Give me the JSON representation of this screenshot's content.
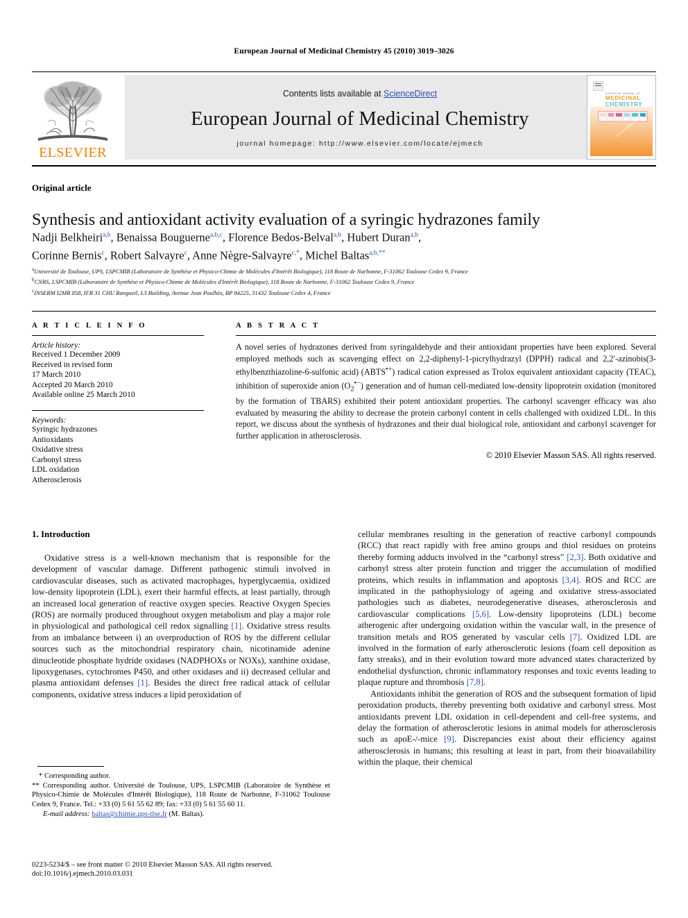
{
  "running_head": "European Journal of Medicinal Chemistry 45 (2010) 3019–3026",
  "masthead": {
    "contents_prefix": "Contents lists available at ",
    "sciencedirect": "ScienceDirect",
    "journal_title": "European Journal of Medicinal Chemistry",
    "homepage": "journal homepage: http://www.elsevier.com/locate/ejmech",
    "publisher_wordmark": "ELSEVIER",
    "brand_orange": "#F08000",
    "link_blue": "#2a4db5",
    "band_grey": "#e9e9e9"
  },
  "cover": {
    "line1": "EUROPEAN JOURNAL OF",
    "line2": "MEDICINAL",
    "line3": "CHEMISTRY"
  },
  "article": {
    "kicker": "Original article",
    "title": "Synthesis and antioxidant activity evaluation of a syringic hydrazones family",
    "authors_line1_a": "Nadji Belkheiri",
    "authors_line1_a_sup": "a,b",
    "authors_line1_b": ", Benaissa Bouguerne",
    "authors_line1_b_sup": "a,b,c",
    "authors_line1_c": ", Florence Bedos-Belval",
    "authors_line1_c_sup": "a,b",
    "authors_line1_d": ", Hubert Duran",
    "authors_line1_d_sup": "a,b",
    "authors_line1_end": ",",
    "authors_line2_a": "Corinne Bernis",
    "authors_line2_a_sup": "c",
    "authors_line2_b": ", Robert Salvayre",
    "authors_line2_b_sup": "c",
    "authors_line2_c": ", Anne Nègre-Salvayre",
    "authors_line2_c_sup": "c,*",
    "authors_line2_d": ", Michel Baltas",
    "authors_line2_d_sup": "a,b,**",
    "affiliations": [
      {
        "sup": "a",
        "text": "Université de Toulouse, UPS, LSPCMIB (Laboratoire de Synthèse et Physico-Chimie de Molécules d'Intérêt Biologique), 118 Route de Narbonne, F-31062 Toulouse Cedex 9, France"
      },
      {
        "sup": "b",
        "text": "CNRS, LSPCMIB (Laboratoire de Synthèse et Physico-Chimie de Molécules d'Intérêt Biologique), 118 Route de Narbonne, F-31062 Toulouse Cedex 9, France"
      },
      {
        "sup": "c",
        "text": "INSERM I2MR 858, IFR 31 CHU Rangueil, L3 Building, Avenue Jean Poulhès, BP 84225, 31432 Toulouse Cedex 4, France"
      }
    ]
  },
  "article_info": {
    "heading": "A R T I C L E   I N F O",
    "history_label": "Article history:",
    "history": [
      "Received 1 December 2009",
      "Received in revised form",
      "17 March 2010",
      "Accepted 20 March 2010",
      "Available online 25 March 2010"
    ],
    "keywords_label": "Keywords:",
    "keywords": [
      "Syringic hydrazones",
      "Antioxidants",
      "Oxidative stress",
      "Carbonyl stress",
      "LDL oxidation",
      "Atherosclerosis"
    ]
  },
  "abstract": {
    "heading": "A B S T R A C T",
    "p1": "A novel series of hydrazones derived from syringaldehyde and their antioxidant properties have been explored. Several employed methods such as scavenging effect on 2,2-diphenyl-1-picrylhydrazyl (DPPH) radical and 2,2′-azinobis(3-ethylbenzthiazoline-6-sulfonic acid) (ABTS",
    "p1_sup1": "•+",
    "p2": ") radical cation expressed as Trolox equivalent antioxidant capacity (TEAC), inhibition of superoxide anion (O",
    "p2_sub": "2",
    "p2_sup": "•−",
    "p3": ") generation and of human cell-mediated low-density lipoprotein oxidation (monitored by the formation of TBARS) exhibited their potent antioxidant properties. The carbonyl scavenger efficacy was also evaluated by measuring the ability to decrease the protein carbonyl content in cells challenged with oxidized LDL. In this report, we discuss about the synthesis of hydrazones and their dual biological role, antioxidant and carbonyl scavenger for further application in atherosclerosis.",
    "copyright": "© 2010 Elsevier Masson SAS. All rights reserved."
  },
  "introduction": {
    "heading": "1.  Introduction",
    "left_p1_part1": "Oxidative stress is a well-known mechanism that is responsible for the development of vascular damage. Different pathogenic stimuli involved in cardiovascular diseases, such as activated macrophages, hyperglycaemia, oxidized low-density lipoprotein (LDL), exert their harmful effects, at least partially, through an increased local generation of reactive oxygen species. Reactive Oxygen Species (ROS) are normally produced throughout oxygen metabolism and play a major role in physiological and pathological cell redox signalling ",
    "ref1": "[1]",
    "left_p1_part2": ". Oxidative stress results from an imbalance between i) an overproduction of ROS by the different cellular sources such as the mitochondrial respiratory chain, nicotinamide adenine dinucleotide phosphate hydride oxidases (NADPHOXs or NOXs), xanthine oxidase, lipoxygenases, cytochromes P450, and other oxidases and ii) decreased cellular and plasma antioxidant defenses ",
    "ref1b": "[1]",
    "left_p1_part3": ". Besides the direct free radical attack of cellular components, oxidative stress induces a lipid peroxidation of",
    "right_p1_part1": "cellular membranes resulting in the generation of reactive carbonyl compounds (RCC) that react rapidly with free amino groups and thiol residues on proteins thereby forming adducts involved in the “carbonyl stress” ",
    "ref23": "[2,3]",
    "right_p1_part2": ". Both oxidative and carbonyl stress alter protein function and trigger the accumulation of modified proteins, which results in inflammation and apoptosis ",
    "ref34": "[3,4]",
    "right_p1_part3": ". ROS and RCC are implicated in the pathophysiology of ageing and oxidative stress-associated pathologies such as diabetes, neurodegenerative diseases, atherosclerosis and cardiovascular complications ",
    "ref56": "[5,6]",
    "right_p1_part4": ". Low-density lipoproteins (LDL) become atherogenic after undergoing oxidation within the vascular wall, in the presence of transition metals and ROS generated by vascular cells ",
    "ref7": "[7]",
    "right_p1_part5": ". Oxidized LDL are involved in the formation of early atherosclerotic lesions (foam cell deposition as fatty streaks), and in their evolution toward more advanced states characterized by endothelial dysfunction, chronic inflammatory responses and toxic events leading to plaque rupture and thrombosis ",
    "ref78": "[7,8]",
    "right_p1_part6": ".",
    "right_p2_part1": "Antioxidants inhibit the generation of ROS and the subsequent formation of lipid peroxidation products, thereby preventing both oxidative and carbonyl stress. Most antioxidants prevent LDL oxidation in cell-dependent and cell-free systems, and delay the formation of atherosclerotic lesions in animal models for atherosclerosis such as apoE-/-mice ",
    "ref9": "[9]",
    "right_p2_part2": ". Discrepancies exist about their efficiency against atherosclerosis in humans; this resulting at least in part, from their bioavailability within the plaque, their chemical"
  },
  "footnotes": {
    "star": "*  Corresponding author.",
    "doublestar": "**  Corresponding author. Université de Toulouse, UPS, LSPCMIB (Laboratoire de Synthèse et Physico-Chimie de Molécules d'Intérêt Biologique), 118 Route de Narbonne, F-31062 Toulouse Cedex 9, France. Tel.: +33 (0) 5 61 55 62 89; fax: +33 (0) 5 61 55 60 11.",
    "email_label": "E-mail address:",
    "email": "baltas@chimie.ups-tlse.fr",
    "email_owner": "(M. Baltas)."
  },
  "imprint": {
    "line1": "0223-5234/$ – see front matter © 2010 Elsevier Masson SAS. All rights reserved.",
    "line2": "doi:10.1016/j.ejmech.2010.03.031"
  }
}
